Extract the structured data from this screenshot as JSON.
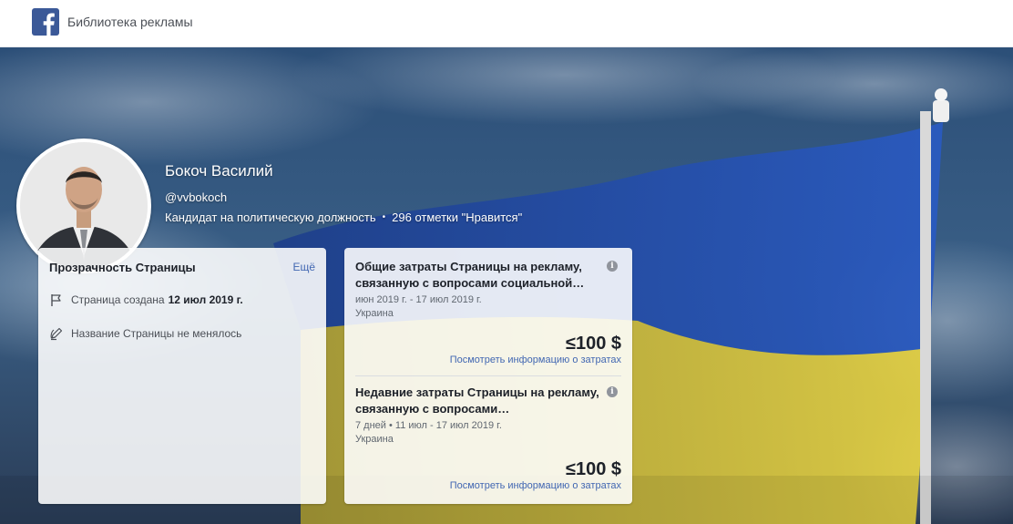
{
  "header": {
    "brand_title": "Библиотека рекламы"
  },
  "profile": {
    "name": "Бокоч Василий",
    "handle": "@vvbokoch",
    "category": "Кандидат на политическую должность",
    "separator": "•",
    "likes": "296 отметки \"Нравится\""
  },
  "transparency": {
    "title": "Прозрачность Страницы",
    "more_label": "Ещё",
    "created_label": "Страница создана",
    "created_date": "12 июл 2019 г.",
    "name_history": "Название Страницы не менялось"
  },
  "spend": {
    "total": {
      "title": "Общие затраты Страницы на рекламу, связанную с вопросами социальной…",
      "period": "июн 2019 г. - 17 июл 2019 г.",
      "region": "Украина",
      "amount": "≤100 $",
      "link": "Посмотреть информацию о затратах"
    },
    "recent": {
      "title": "Недавние затраты Страницы на рекламу, связанную с вопросами…",
      "period": "7 дней • 11 июл - 17 июл 2019 г.",
      "region": "Украина",
      "amount": "≤100 $",
      "link": "Посмотреть информацию о затратах"
    },
    "info_glyph": "i"
  },
  "colors": {
    "facebook_blue": "#3b5998",
    "link_blue": "#4267b2",
    "flag_blue": "#1f4fa8",
    "flag_yellow": "#d8c640"
  },
  "icons": {
    "logo": "facebook-logo-icon",
    "flag": "flag-icon",
    "edit": "pencil-edit-icon",
    "info": "info-icon"
  }
}
